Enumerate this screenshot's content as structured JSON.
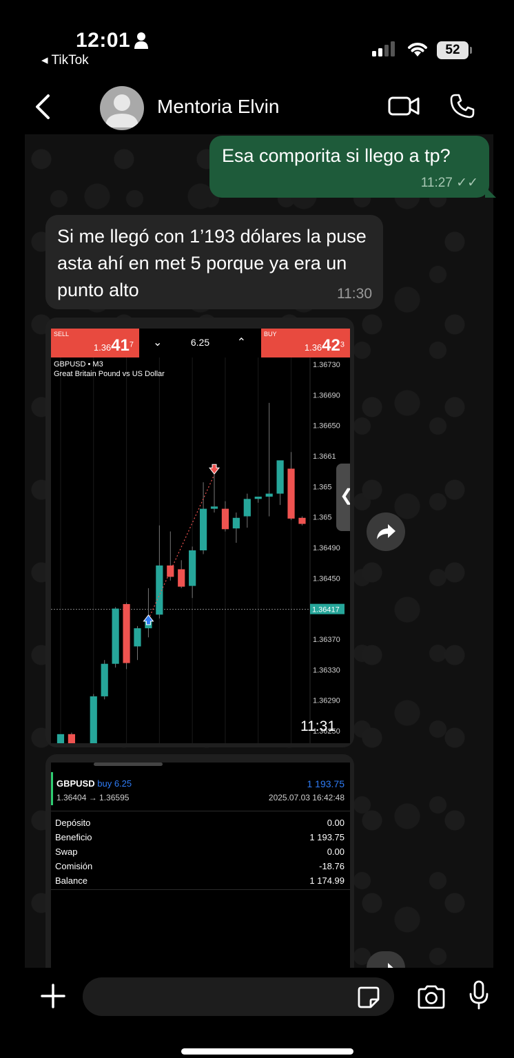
{
  "status_bar": {
    "time": "12:01",
    "back_app": "◂ TikTok",
    "battery": "52"
  },
  "header": {
    "contact_name": "Mentoria Elvin"
  },
  "messages": {
    "outgoing": {
      "text": "Esa comporita si llego a tp?",
      "time": "11:27 ✓✓"
    },
    "incoming": {
      "text": "Si me llegó con 1’193 dólares la puse asta ahí en met 5 porque ya era un punto alto",
      "time": "11:30"
    }
  },
  "trade_screen": {
    "sell_label": "SELL",
    "sell_price_prefix": "1.36",
    "sell_price_big": "41",
    "sell_price_sup": "7",
    "buy_label": "BUY",
    "buy_price_prefix": "1.36",
    "buy_price_big": "42",
    "buy_price_sup": "3",
    "volume": "6.25",
    "symbol": "GBPUSD • M3",
    "symbol_desc": "Great Britain Pound vs US Dollar",
    "image_time": "11:31"
  },
  "chart_data": {
    "type": "candlestick",
    "y_ticks": [
      "1.36730",
      "1.36690",
      "1.36650",
      "1.3661",
      "1.365",
      "1.365",
      "1.36490",
      "1.36450",
      "1.36410",
      "1.36370",
      "1.36330",
      "1.36290",
      "1.36250"
    ],
    "ylim": [
      1.3624,
      1.3675
    ],
    "current_price_label": "1.36417",
    "current_price": 1.36417,
    "entry": {
      "price": 1.36404,
      "candle": 8
    },
    "exit": {
      "price": 1.36595,
      "candle": 14
    },
    "candles": [
      {
        "o": 1.36236,
        "h": 1.3625,
        "c": 1.36252,
        "l": 1.36232
      },
      {
        "o": 1.36252,
        "h": 1.36254,
        "c": 1.36236,
        "l": 1.36232
      },
      {
        "o": 1.36236,
        "h": 1.3624,
        "c": 1.3624,
        "l": 1.36234
      },
      {
        "o": 1.3624,
        "h": 1.36305,
        "c": 1.36302,
        "l": 1.36238
      },
      {
        "o": 1.36302,
        "h": 1.3635,
        "c": 1.36345,
        "l": 1.36298
      },
      {
        "o": 1.36345,
        "h": 1.3642,
        "c": 1.36418,
        "l": 1.3634
      },
      {
        "o": 1.36424,
        "h": 1.36426,
        "c": 1.36346,
        "l": 1.36338
      },
      {
        "o": 1.36368,
        "h": 1.36395,
        "c": 1.36392,
        "l": 1.3635
      },
      {
        "o": 1.36392,
        "h": 1.36445,
        "c": 1.36404,
        "l": 1.3638
      },
      {
        "o": 1.3641,
        "h": 1.36528,
        "c": 1.36475,
        "l": 1.36405
      },
      {
        "o": 1.36475,
        "h": 1.3652,
        "c": 1.3646,
        "l": 1.36455
      },
      {
        "o": 1.3647,
        "h": 1.36482,
        "c": 1.36447,
        "l": 1.36445
      },
      {
        "o": 1.36448,
        "h": 1.365,
        "c": 1.36495,
        "l": 1.36432
      },
      {
        "o": 1.36495,
        "h": 1.36585,
        "c": 1.3655,
        "l": 1.3649
      },
      {
        "o": 1.3655,
        "h": 1.36595,
        "c": 1.36553,
        "l": 1.36545
      },
      {
        "o": 1.3655,
        "h": 1.3656,
        "c": 1.36523,
        "l": 1.3652
      },
      {
        "o": 1.36524,
        "h": 1.36545,
        "c": 1.36538,
        "l": 1.36505
      },
      {
        "o": 1.3654,
        "h": 1.3657,
        "c": 1.36563,
        "l": 1.36525
      },
      {
        "o": 1.36563,
        "h": 1.36565,
        "c": 1.36566,
        "l": 1.36558
      },
      {
        "o": 1.36566,
        "h": 1.3669,
        "c": 1.3657,
        "l": 1.3654
      },
      {
        "o": 1.3657,
        "h": 1.36607,
        "c": 1.36614,
        "l": 1.36555
      },
      {
        "o": 1.36603,
        "h": 1.36625,
        "c": 1.36537,
        "l": 1.36535
      },
      {
        "o": 1.36538,
        "h": 1.3654,
        "c": 1.3653,
        "l": 1.36528
      }
    ]
  },
  "trade_detail": {
    "symbol": "GBPUSD",
    "side": "buy 6.25",
    "profit": "1 193.75",
    "prices": "1.36404 → 1.36595",
    "date": "2025.07.03 16:42:48",
    "rows": [
      {
        "k": "Depósito",
        "v": "0.00"
      },
      {
        "k": "Beneficio",
        "v": "1 193.75"
      },
      {
        "k": "Swap",
        "v": "0.00"
      },
      {
        "k": "Comisión",
        "v": "-18.76"
      },
      {
        "k": "Balance",
        "v": "1 174.99"
      }
    ]
  },
  "colors": {
    "outgoing_bubble": "#1e5b3a",
    "incoming_bubble": "#252525",
    "bull": "#26a69a",
    "bear": "#ef5350",
    "profit_blue": "#2f7cf6"
  }
}
